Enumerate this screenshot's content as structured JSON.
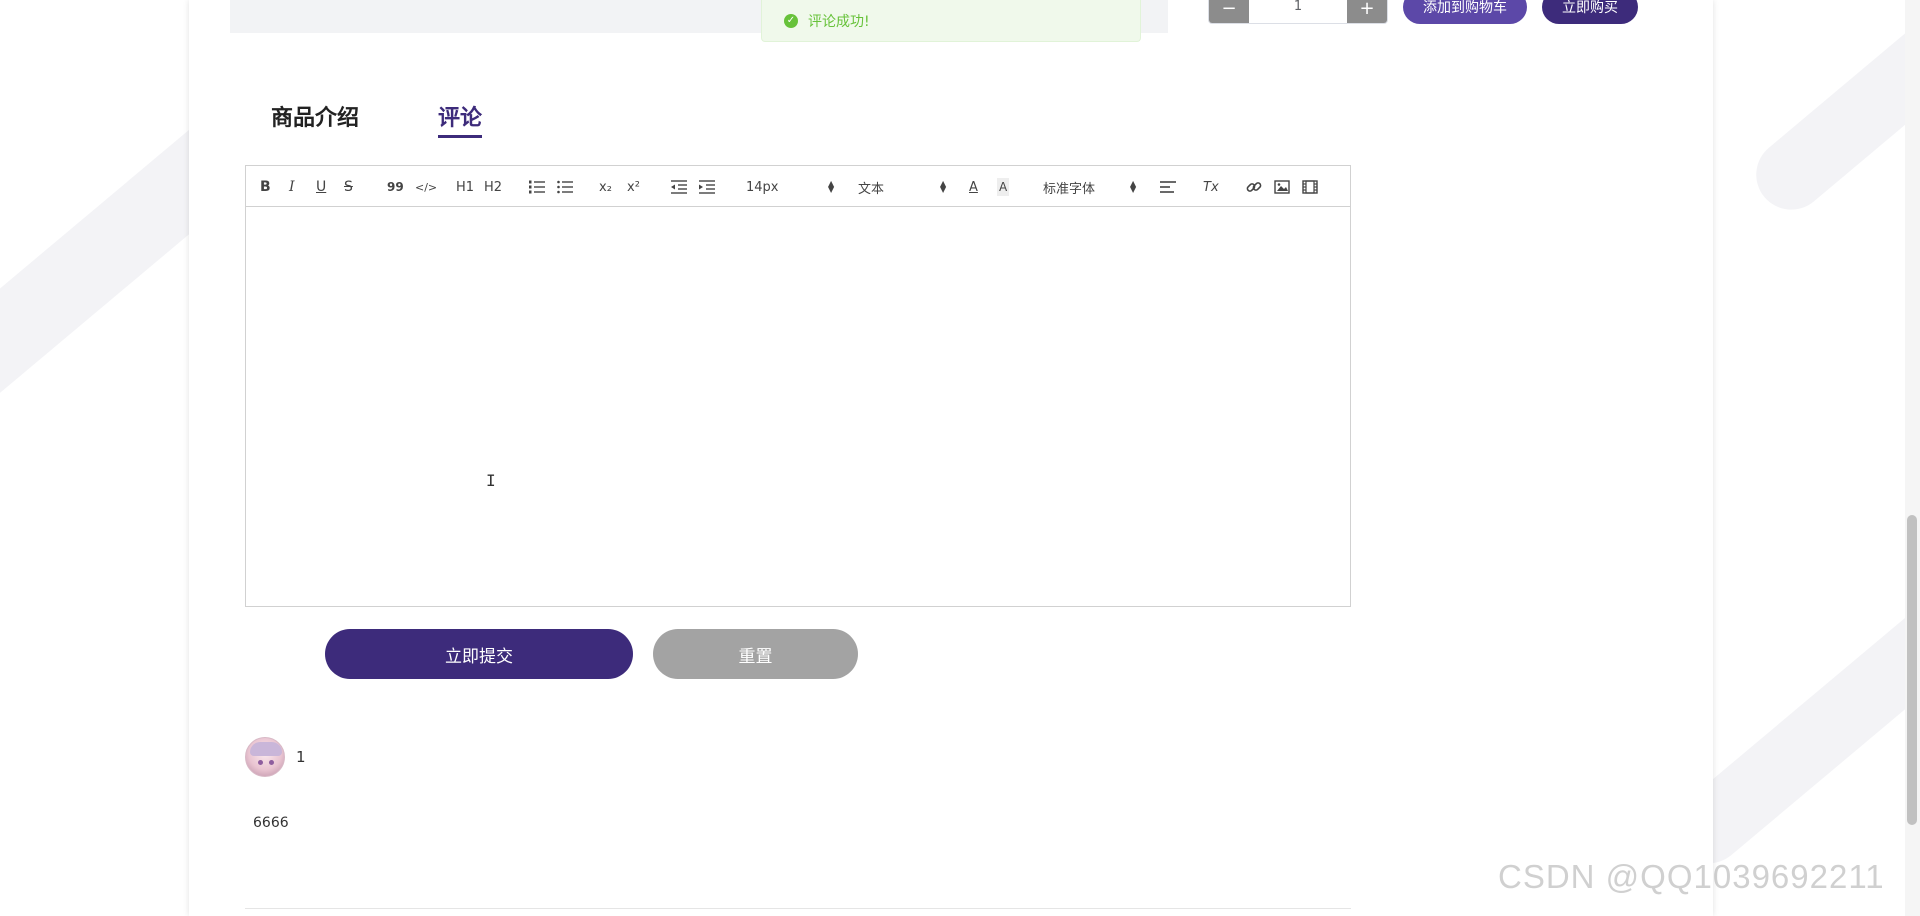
{
  "toast": {
    "message": "评论成功!",
    "icon": "success-check-icon",
    "color": "#67c23a"
  },
  "product": {
    "quantity_minus": "−",
    "quantity_value": "1",
    "quantity_plus": "+",
    "add_to_cart_label": "添加到购物车",
    "buy_now_label": "立即购买"
  },
  "tabs": [
    {
      "label": "商品介绍",
      "active": false
    },
    {
      "label": "评论",
      "active": true
    }
  ],
  "editor": {
    "toolbar": {
      "bold": "B",
      "italic": "I",
      "underline": "U",
      "strike": "S",
      "blockquote": "99",
      "code": "</>",
      "h1": "H1",
      "h2": "H2",
      "ordered_list": "ordered-list-icon",
      "bullet_list": "bullet-list-icon",
      "subscript": "x₂",
      "superscript": "x²",
      "outdent": "outdent-icon",
      "indent": "indent-icon",
      "font_size": "14px",
      "header_select": "文本",
      "font_color": "A",
      "background_color": "A",
      "font_family": "标准字体",
      "align": "align-icon",
      "clean": "Tx",
      "link": "link-icon",
      "image": "image-icon",
      "video": "video-icon"
    }
  },
  "actions": {
    "submit_label": "立即提交",
    "reset_label": "重置"
  },
  "comment": {
    "username": "1",
    "text": "6666"
  },
  "colors": {
    "primary": "#3d2b7b",
    "secondary": "#5c48a8",
    "gray": "#a3a3a3"
  },
  "watermark": "CSDN @QQ1039692211"
}
